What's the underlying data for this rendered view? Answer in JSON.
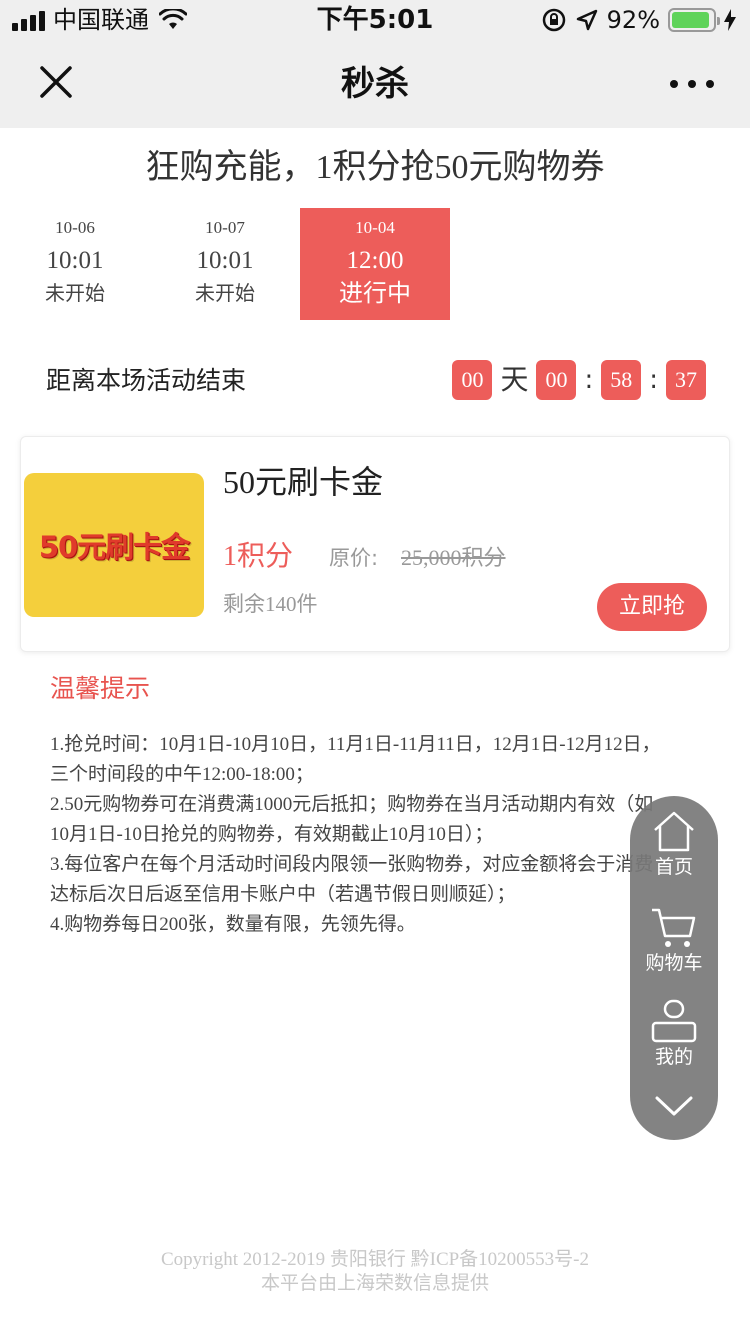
{
  "status_bar": {
    "carrier": "中国联通",
    "time": "下午5:01",
    "battery": "92%",
    "battery_level": 0.92
  },
  "nav": {
    "title": "秒杀",
    "close_icon": "close-icon",
    "more_icon": "more-icon"
  },
  "headline": "狂购充能，1积分抢50元购物券",
  "sessions": [
    {
      "date": "10-06",
      "time": "10:01",
      "status": "未开始",
      "active": false
    },
    {
      "date": "10-07",
      "time": "10:01",
      "status": "未开始",
      "active": false
    },
    {
      "date": "10-04",
      "time": "12:00",
      "status": "进行中",
      "active": true
    }
  ],
  "countdown": {
    "label": "距离本场活动结束",
    "days": "00",
    "day_unit": "天",
    "hours": "00",
    "minutes": "58",
    "seconds": "37",
    "separator": ":"
  },
  "product": {
    "image_text": "50元刷卡金",
    "name": "50元刷卡金",
    "price": "1积分",
    "original_label": "原价:",
    "original_price": "25,000积分",
    "stock": "剩余140件",
    "button": "立即抢"
  },
  "tips": {
    "title": "温馨提示",
    "lines": [
      "1.抢兑时间：10月1日-10月10日，11月1日-11月11日，12月1日-12月12日，",
      "三个时间段的中午12:00-18:00；",
      "2.50元购物券可在消费满1000元后抵扣；购物券在当月活动期内有效（如",
      "10月1日-10日抢兑的购物券，有效期截止10月10日）；",
      "3.每位客户在每个月活动时间段内限领一张购物券，对应金额将会于消费",
      "达标后次日后返至信用卡账户中（若遇节假日则顺延）；",
      "4.购物券每日200张，数量有限，先领先得。"
    ]
  },
  "float_menu": {
    "home": "首页",
    "cart": "购物车",
    "mine": "我的"
  },
  "footer": {
    "line1": "Copyright 2012-2019 贵阳银行 黔ICP备10200553号-2",
    "line2": "本平台由上海荣数信息提供"
  },
  "colors": {
    "accent": "#ed5d5a",
    "nav_bg": "#efefef",
    "float_bg": "#787878",
    "product_bg": "#f4cf3c"
  }
}
